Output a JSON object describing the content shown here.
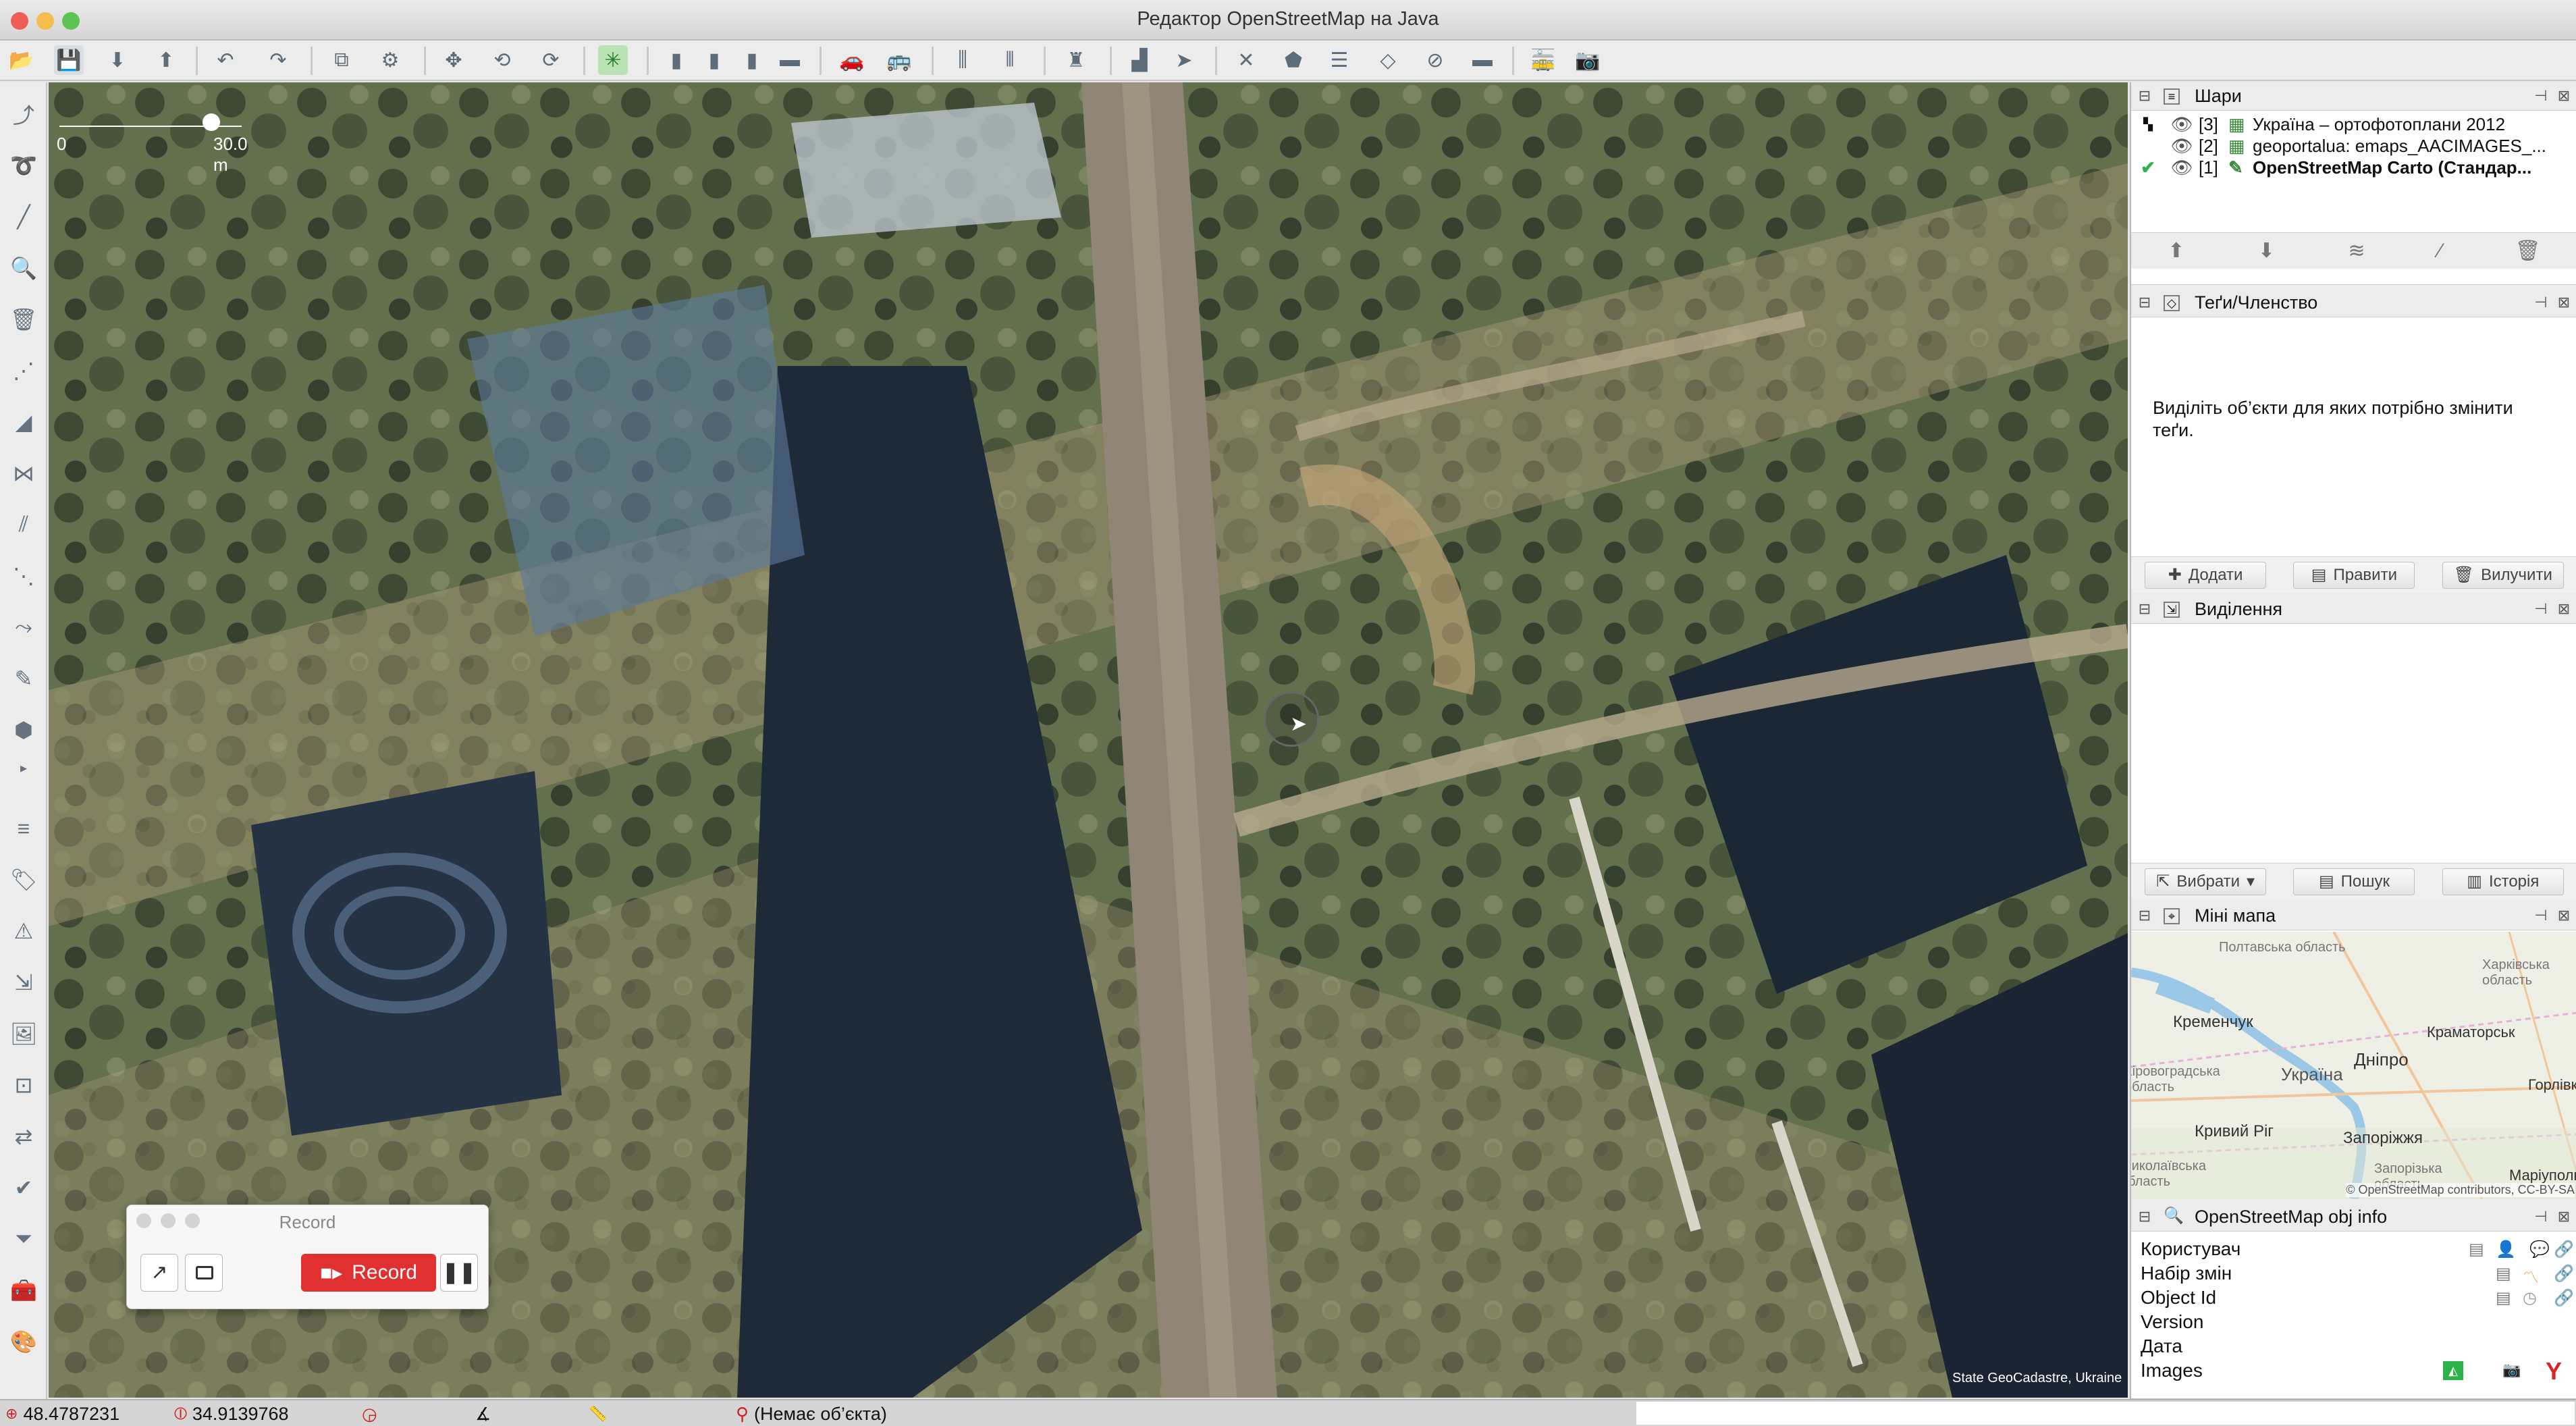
{
  "window": {
    "title": "Редактор OpenStreetMap на Java"
  },
  "toolbar": {
    "icons": [
      "open-file-icon",
      "save-icon",
      "download-icon",
      "upload-icon",
      "undo-icon",
      "redo-icon",
      "preferences-icon",
      "copy-icon",
      "move-icon",
      "rotate-icon",
      "refresh-icon",
      "active-layer-icon"
    ]
  },
  "map": {
    "scale": {
      "zero": "0",
      "end": "30.0 m"
    },
    "attribution": "State GeoCadastre, Ukraine"
  },
  "record_widget": {
    "title": "Record",
    "button": "Record"
  },
  "status": {
    "lat": "48.4787231",
    "lon": "34.9139768",
    "object": "(Немає об’єкта)"
  },
  "panels": {
    "layers": {
      "title": "Шари",
      "items": [
        {
          "index": "[3]",
          "name": "Україна – ортофотоплани 2012",
          "active": false
        },
        {
          "index": "[2]",
          "name": "geoportalua: emaps_AACIMAGES_...",
          "active": false
        },
        {
          "index": "[1]",
          "name": "OpenStreetMap Carto (Стандар...",
          "active": true
        }
      ]
    },
    "tags": {
      "title": "Теґи/Членство",
      "message": "Виділіть об’єкти для яких потрібно змінити теґи.",
      "buttons": {
        "add": "Додати",
        "edit": "Правити",
        "delete": "Вилучити"
      }
    },
    "selection": {
      "title": "Виділення",
      "buttons": {
        "select": "Вибрати",
        "search": "Пошук",
        "history": "Історія"
      }
    },
    "minimap": {
      "title": "Міні мапа",
      "labels": [
        "Полтавська область",
        "Харківська область",
        "Кременчук",
        "Краматорськ",
        "Кіровоградська область",
        "Дніпро",
        "Україна",
        "Горлівка",
        "Кривий Ріг",
        "Запоріжжя",
        "Маріуполь",
        "Миколаївська область",
        "Запорізька область"
      ],
      "attribution": "© OpenStreetMap contributors, CC-BY-SA"
    },
    "objinfo": {
      "title": "OpenStreetMap obj info",
      "rows": [
        "Користувач",
        "Набір змін",
        "Object Id",
        "Version",
        "Дата",
        "Images"
      ]
    }
  },
  "colors": {
    "accent": "#d62828",
    "record": "#e0302f",
    "selection_green": "#2bb34a"
  }
}
